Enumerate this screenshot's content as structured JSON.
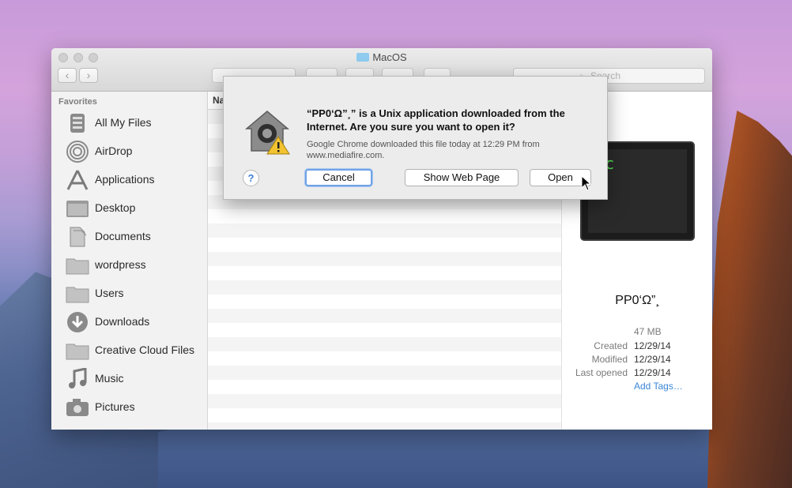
{
  "window": {
    "title": "MacOS",
    "search_placeholder": "Search"
  },
  "sidebar": {
    "heading": "Favorites",
    "items": [
      {
        "label": "All My Files",
        "icon": "all-files-icon"
      },
      {
        "label": "AirDrop",
        "icon": "airdrop-icon"
      },
      {
        "label": "Applications",
        "icon": "applications-icon"
      },
      {
        "label": "Desktop",
        "icon": "desktop-folder-icon"
      },
      {
        "label": "Documents",
        "icon": "documents-icon"
      },
      {
        "label": "wordpress",
        "icon": "folder-icon"
      },
      {
        "label": "Users",
        "icon": "folder-icon"
      },
      {
        "label": "Downloads",
        "icon": "downloads-icon"
      },
      {
        "label": "Creative Cloud Files",
        "icon": "folder-icon"
      },
      {
        "label": "Music",
        "icon": "music-icon"
      },
      {
        "label": "Pictures",
        "icon": "camera-icon"
      }
    ]
  },
  "list": {
    "column_header": "Na"
  },
  "preview": {
    "screen_text": "xec",
    "file_name": "PP0‘Ω”¸",
    "size": "47 MB",
    "created_label": "Created",
    "created_value": "12/29/14",
    "modified_label": "Modified",
    "modified_value": "12/29/14",
    "last_opened_label": "Last opened",
    "last_opened_value": "12/29/14",
    "add_tags": "Add Tags…"
  },
  "dialog": {
    "title": "“PP0‘Ω”¸” is a Unix application downloaded from the Internet. Are you sure you want to open it?",
    "body": "Google Chrome downloaded this file today at 12:29 PM from www.mediafire.com.",
    "help_label": "?",
    "cancel_label": "Cancel",
    "show_web_page_label": "Show Web Page",
    "open_label": "Open"
  },
  "colors": {
    "accent": "#3a86d8",
    "terminal_text": "#52e052",
    "focus_ring": "#6fa3e6"
  }
}
